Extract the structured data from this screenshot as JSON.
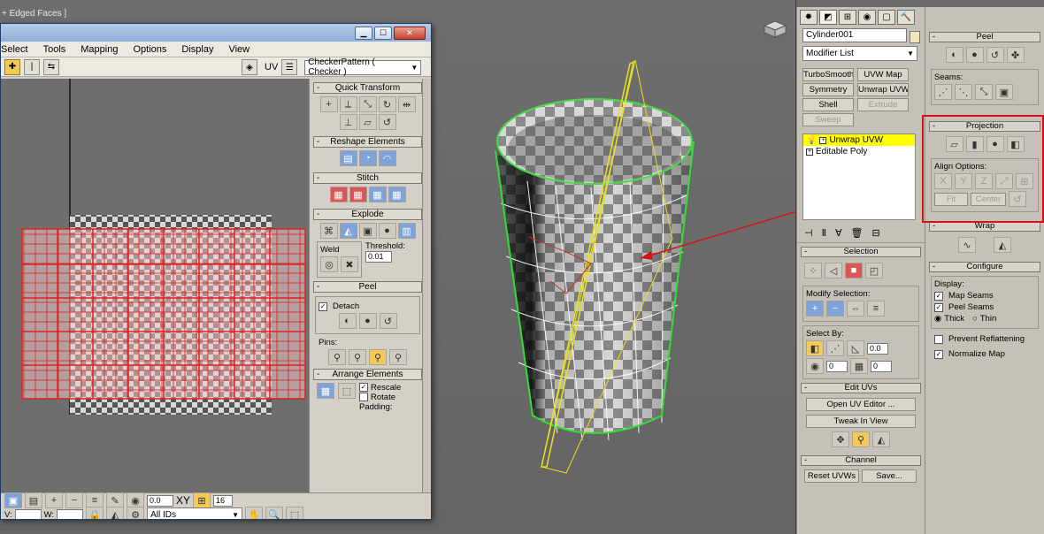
{
  "viewport": {
    "label": "+ Edged Faces ]"
  },
  "uv_editor": {
    "menu": [
      "Select",
      "Tools",
      "Mapping",
      "Options",
      "Display",
      "View"
    ],
    "uv_label": "UV",
    "texture_dropdown": "CheckerPattern  ( Checker )",
    "quick_transform": "Quick Transform",
    "reshape_elements": "Reshape Elements",
    "stitch": "Stitch",
    "explode": "Explode",
    "weld": "Weld",
    "threshold_label": "Threshold:",
    "threshold_value": "0.01",
    "peel": "Peel",
    "detach": "Detach",
    "pins": "Pins:",
    "arrange_elements": "Arrange Elements",
    "rescale": "Rescale",
    "rotate": "Rotate",
    "padding": "Padding:",
    "bottom_value": "0.0",
    "xy_label": "XY",
    "grid_value": "16",
    "u_label": "V:",
    "w_label": "W:",
    "ids_dropdown": "All IDs"
  },
  "command_panel": {
    "object_name": "Cylinder001",
    "modifier_list": "Modifier List",
    "buttons": [
      "TurboSmooth",
      "UVW Map",
      "Symmetry",
      "Unwrap UVW",
      "Shell",
      "Extrude",
      "Sweep"
    ],
    "disabled_buttons": [
      "Extrude",
      "Sweep"
    ],
    "stack": [
      {
        "label": "Unwrap UVW",
        "selected": true
      },
      {
        "label": "Editable Poly",
        "selected": false
      }
    ],
    "selection": "Selection",
    "modify_selection": "Modify Selection:",
    "select_by": "Select By:",
    "select_angle": "0.0",
    "select_val1": "0",
    "select_val2": "0",
    "edit_uvs": "Edit UVs",
    "open_uv_editor": "Open UV Editor ...",
    "tweak_in_view": "Tweak In View",
    "channel": "Channel",
    "reset_uvws": "Reset UVWs",
    "save": "Save..."
  },
  "command_panel_right": {
    "peel": "Peel",
    "seams": "Seams:",
    "projection": "Projection",
    "align_options": "Align Options:",
    "align_axes": [
      "X",
      "Y",
      "Z"
    ],
    "fit": "Fit",
    "center": "Center",
    "wrap": "Wrap",
    "configure": "Configure",
    "display": "Display:",
    "map_seams": "Map Seams",
    "peel_seams": "Peel Seams",
    "thick": "Thick",
    "thin": "Thin",
    "prevent_reflattening": "Prevent Reflattening",
    "normalize_map": "Normalize Map"
  },
  "colors": {
    "selection_red": "#e02020",
    "seam_green": "#33dd33",
    "highlight_red": "#d21414",
    "stack_selected": "#ffff00"
  }
}
